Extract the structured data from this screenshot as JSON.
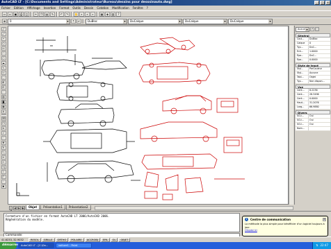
{
  "window": {
    "title": "AutoCAD LT - [C:\\Documents and Settings\\Administrateur\\Bureau\\dessins pour desssinauto.dwg]",
    "buttons": [
      "_",
      "□",
      "x"
    ]
  },
  "menubar": [
    "Fichier",
    "Edition",
    "Affichage",
    "Insertion",
    "Format",
    "Outils",
    "Dessin",
    "Cotation",
    "Modification",
    "Fenêtre",
    "?"
  ],
  "toolbar_row2": {
    "layer_value": "0",
    "color_value": "DuBloc",
    "linetype_value": "DuCalque",
    "lineweight_value": "DuCalque",
    "plot_value": "DuCalque"
  },
  "drawing_tabs": {
    "nav": [
      "|◀",
      "◀",
      "▶",
      "▶|"
    ],
    "items": [
      {
        "label": "Objet",
        "active": true
      },
      {
        "label": "Présentation1",
        "active": false
      },
      {
        "label": "Présentation2",
        "active": false
      }
    ]
  },
  "properties": {
    "selector_value": "Aucune",
    "sections": [
      {
        "title": "Général",
        "rows": [
          {
            "k": "Coul...",
            "v": "DuBloc"
          },
          {
            "k": "Calque",
            "v": "0"
          },
          {
            "k": "Typ...",
            "v": "DuC..."
          },
          {
            "k": "Éch...",
            "v": "1.0000"
          },
          {
            "k": "Épa...",
            "v": "DuC..."
          },
          {
            "k": "Épa...",
            "v": "0.0000"
          }
        ]
      },
      {
        "title": "Style de tracé",
        "rows": [
          {
            "k": "Styl...",
            "v": "ParCouleur"
          },
          {
            "k": "Styl...",
            "v": "Aucune"
          },
          {
            "k": "Tabl...",
            "v": "Objet"
          },
          {
            "k": "Typ...",
            "v": "Non dispon..."
          }
        ]
      },
      {
        "title": "Vue",
        "rows": [
          {
            "k": "Cent...",
            "v": "8.2236"
          },
          {
            "k": "Cent...",
            "v": "28.3496"
          },
          {
            "k": "Cent...",
            "v": "0.0000"
          },
          {
            "k": "Haut...",
            "v": "31.2076"
          },
          {
            "k": "Larg...",
            "v": "66.9880"
          }
        ]
      },
      {
        "title": "Divers",
        "rows": [
          {
            "k": "SCU...",
            "v": "Oui"
          },
          {
            "k": "SCU...",
            "v": "Oui"
          },
          {
            "k": "SCU...",
            "v": "Oui"
          },
          {
            "k": "Nom...",
            "v": ""
          }
        ]
      }
    ]
  },
  "command": {
    "history": [
      "Fermeture d'un fichier en format AutoCAD LT 2006/AutoCAD 2006.",
      "Régénération du modèle."
    ],
    "prompt": "Commande:"
  },
  "balloon": {
    "title": "Centre de communication",
    "body": "La méthode la plus simple pour bénéficier d'un logiciel toujours à jour.",
    "link": "Cliquez ici"
  },
  "status": {
    "coords": "41.6233, 32.9032",
    "toggles": [
      "RESOL",
      "GRILLE",
      "ORTHO",
      "POLAIRE",
      "ACCROBJ",
      "EPA",
      "OL",
      "OBJET"
    ]
  },
  "taskbar": {
    "start": "démarrer",
    "tasks": [
      {
        "label": "AutoCAD LT - [C:\\Do...",
        "active": true
      },
      {
        "label": "voiture1 - Paint",
        "active": false
      }
    ],
    "clock": "22:47"
  },
  "colors": {
    "titlebar": "#0a246a",
    "drawing_black": "#000000",
    "drawing_red": "#cc0000",
    "taskbar": "#245edb"
  }
}
